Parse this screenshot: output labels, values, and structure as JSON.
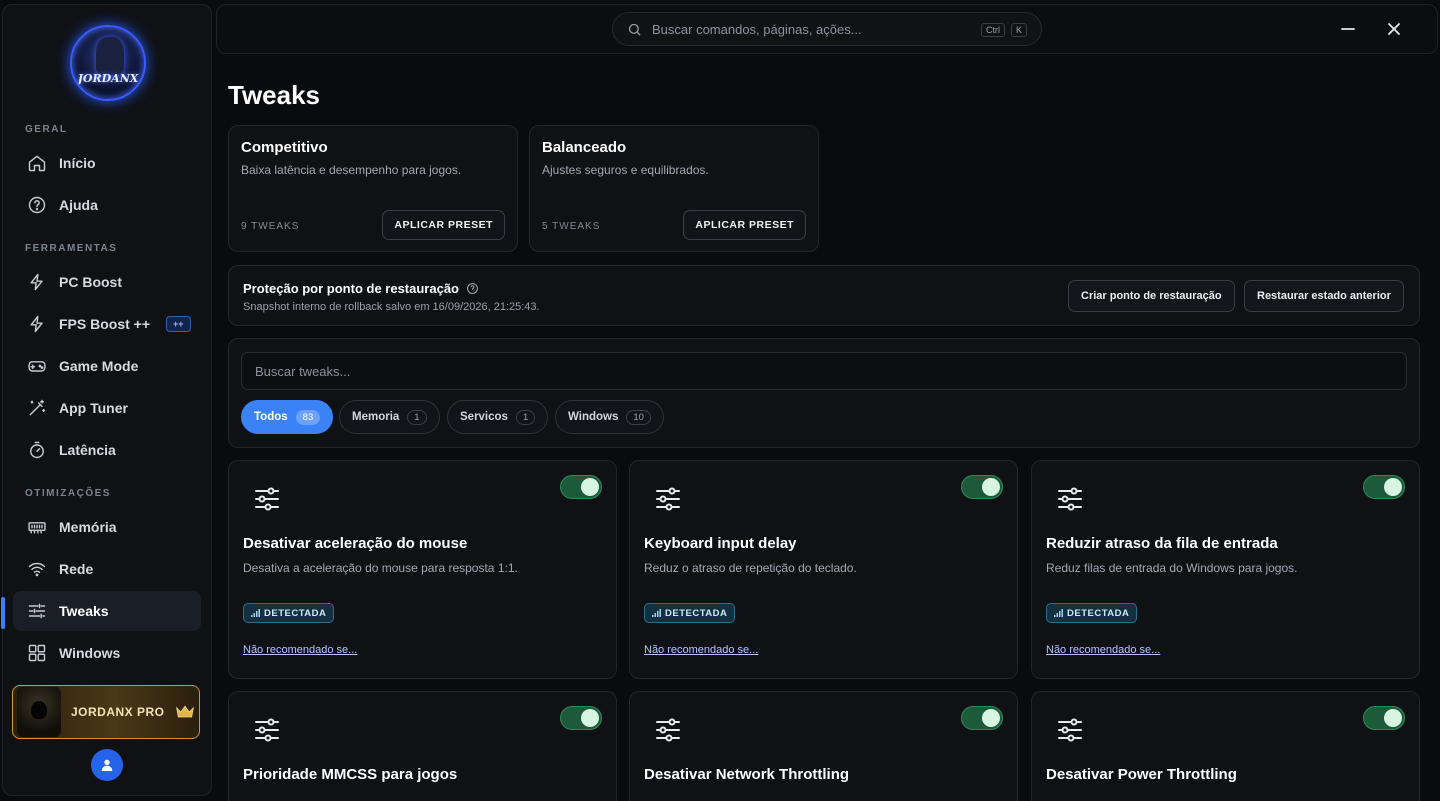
{
  "sidebar": {
    "logo_text": "JORDANX",
    "sections": {
      "geral": "GERAL",
      "ferramentas": "FERRAMENTAS",
      "otimizacoes": "OTIMIZAÇÕES"
    },
    "items": [
      {
        "label": "Início",
        "icon": "home-icon"
      },
      {
        "label": "Ajuda",
        "icon": "help-circle-icon"
      },
      {
        "label": "PC Boost",
        "icon": "bolt-icon"
      },
      {
        "label": "FPS Boost ++",
        "icon": "bolt-icon",
        "badge": "++"
      },
      {
        "label": "Game Mode",
        "icon": "gamepad-icon"
      },
      {
        "label": "App Tuner",
        "icon": "magic-wand-icon"
      },
      {
        "label": "Latência",
        "icon": "stopwatch-icon"
      },
      {
        "label": "Memória",
        "icon": "memory-icon"
      },
      {
        "label": "Rede",
        "icon": "wifi-icon"
      },
      {
        "label": "Tweaks",
        "icon": "sliders-icon",
        "active": true
      },
      {
        "label": "Windows",
        "icon": "grid-icon"
      }
    ],
    "pro_label": "JORDANX PRO"
  },
  "topbar": {
    "search_placeholder": "Buscar comandos, páginas, ações...",
    "kbd_ctrl": "Ctrl",
    "kbd_k": "K"
  },
  "page": {
    "title": "Tweaks"
  },
  "presets": [
    {
      "title": "Competitivo",
      "desc": "Baixa latência e desempenho para jogos.",
      "count": "9 TWEAKS",
      "button": "APLICAR PRESET"
    },
    {
      "title": "Balanceado",
      "desc": "Ajustes seguros e equilibrados.",
      "count": "5 TWEAKS",
      "button": "APLICAR PRESET"
    }
  ],
  "restore": {
    "title": "Proteção por ponto de restauração",
    "subtitle": "Snapshot interno de rollback salvo em 16/09/2026, 21:25:43.",
    "create_btn": "Criar ponto de restauração",
    "restore_btn": "Restaurar estado anterior"
  },
  "filters": {
    "search_placeholder": "Buscar tweaks...",
    "chips": [
      {
        "label": "Todos",
        "count": "83",
        "active": true
      },
      {
        "label": "Memoria",
        "count": "1"
      },
      {
        "label": "Servicos",
        "count": "1"
      },
      {
        "label": "Windows",
        "count": "10"
      }
    ]
  },
  "tweaks": [
    {
      "title": "Desativar aceleração do mouse",
      "desc": "Desativa a aceleração do mouse para resposta 1:1.",
      "badge": "DETECTADA",
      "link": "Não recomendado se...",
      "enabled": true
    },
    {
      "title": "Keyboard input delay",
      "desc": "Reduz o atraso de repetição do teclado.",
      "badge": "DETECTADA",
      "link": "Não recomendado se...",
      "enabled": true
    },
    {
      "title": "Reduzir atraso da fila de entrada",
      "desc": "Reduz filas de entrada do Windows para jogos.",
      "badge": "DETECTADA",
      "link": "Não recomendado se...",
      "enabled": true
    },
    {
      "title": "Prioridade MMCSS para jogos",
      "desc": "",
      "enabled": true
    },
    {
      "title": "Desativar Network Throttling",
      "desc": "",
      "enabled": true
    },
    {
      "title": "Desativar Power Throttling",
      "desc": "",
      "enabled": true
    }
  ],
  "colors": {
    "accent": "#3b82f6",
    "toggle_on": "#1d5a3a",
    "badge_detected": "#12303f",
    "pro_gold": "#c99a2e"
  }
}
